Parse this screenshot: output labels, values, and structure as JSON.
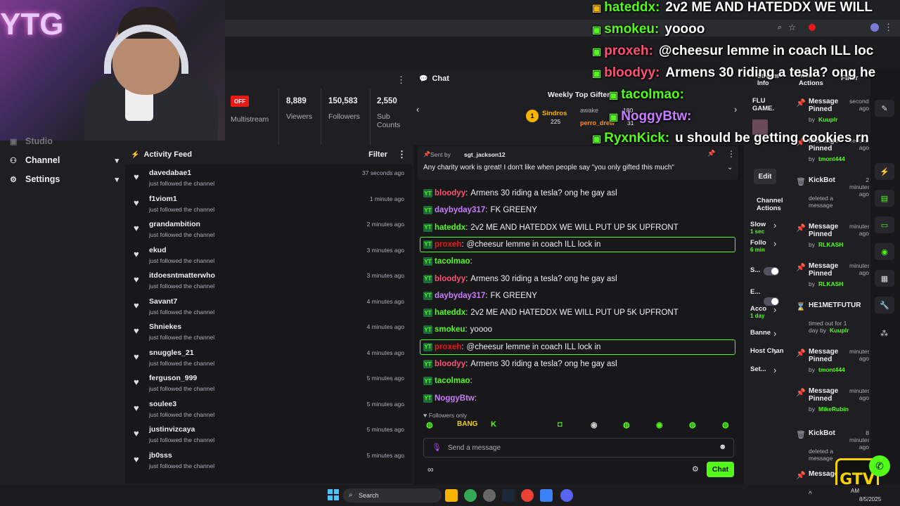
{
  "left_nav": {
    "items": [
      {
        "label": "Studio",
        "icon": "studio-icon"
      },
      {
        "label": "Channel",
        "icon": "channel-icon"
      },
      {
        "label": "Settings",
        "icon": "gear-icon"
      }
    ]
  },
  "webcam": {
    "overlay_text": "YTG"
  },
  "stream_stats": {
    "status": "OFF",
    "multistream": "Multistream",
    "viewers_value": "8,889",
    "viewers_label": "Viewers",
    "followers_value": "150,583",
    "followers_label": "Followers",
    "subs_value": "2,550",
    "subs_label": "Sub Counts"
  },
  "activity_feed": {
    "title": "Activity Feed",
    "filter": "Filter",
    "items": [
      {
        "name": "davedabae1",
        "action": "just followed the channel",
        "time": "37 seconds ago"
      },
      {
        "name": "f1viom1",
        "action": "just followed the channel",
        "time": "1 minute ago"
      },
      {
        "name": "grandambition",
        "action": "just followed the channel",
        "time": "2 minutes ago"
      },
      {
        "name": "ekud",
        "action": "just followed the channel",
        "time": "3 minutes ago"
      },
      {
        "name": "itdoesntmatterwho",
        "action": "just followed the channel",
        "time": "3 minutes ago"
      },
      {
        "name": "Savant7",
        "action": "just followed the channel",
        "time": "4 minutes ago"
      },
      {
        "name": "Shniekes",
        "action": "just followed the channel",
        "time": "4 minutes ago"
      },
      {
        "name": "snuggles_21",
        "action": "just followed the channel",
        "time": "4 minutes ago"
      },
      {
        "name": "ferguson_999",
        "action": "just followed the channel",
        "time": "5 minutes ago"
      },
      {
        "name": "soulee3",
        "action": "just followed the channel",
        "time": "5 minutes ago"
      },
      {
        "name": "justinvizcaya",
        "action": "just followed the channel",
        "time": "5 minutes ago"
      },
      {
        "name": "jb0sss",
        "action": "just followed the channel",
        "time": "5 minutes ago"
      }
    ]
  },
  "chat": {
    "title": "Chat",
    "gifters_title": "Weekly Top Gifters",
    "gifter1": {
      "rank": "1",
      "name": "Sindros",
      "count": "225"
    },
    "gifter2": {
      "name": "awake",
      "count": ""
    },
    "gifter3": {
      "name": "perro_drew",
      "count": "31"
    },
    "gifter_extra": "180",
    "pinned_by_label": "Sent by",
    "pinned_by": "sgt_jackson12",
    "pinned_text": "Any charity work is great! I don't like when people say \"you only gifted this much\"",
    "messages": [
      {
        "user": "bloodyy",
        "text": "Armens 30 riding a tesla? ong he gay asl",
        "color": "#ff4f72",
        "hl": false
      },
      {
        "user": "daybyday317",
        "text": "FK GREENY",
        "color": "#c77dff",
        "hl": false
      },
      {
        "user": "hateddx",
        "text": "2v2 ME AND HATEDDX WE WILL PUT UP 5K UPFRONT",
        "color": "#53fc18",
        "hl": false
      },
      {
        "user": "proxeh",
        "text": "@cheesur lemme in coach ILL lock in",
        "color": "#e91916",
        "hl": true
      },
      {
        "user": "tacolmao",
        "text": "",
        "color": "#53fc18",
        "hl": false
      },
      {
        "user": "bloodyy",
        "text": "Armens 30 riding a tesla? ong he gay asl",
        "color": "#ff4f72",
        "hl": false
      },
      {
        "user": "daybyday317",
        "text": "FK GREENY",
        "color": "#c77dff",
        "hl": false
      },
      {
        "user": "hateddx",
        "text": "2v2 ME AND HATEDDX WE WILL PUT UP 5K UPFRONT",
        "color": "#53fc18",
        "hl": false
      },
      {
        "user": "smokeu",
        "text": "yoooo",
        "color": "#53fc18",
        "hl": false
      },
      {
        "user": "proxeh",
        "text": "@cheesur lemme in coach ILL lock in",
        "color": "#e91916",
        "hl": true
      },
      {
        "user": "bloodyy",
        "text": "Armens 30 riding a tesla? ong he gay asl",
        "color": "#ff4f72",
        "hl": false
      },
      {
        "user": "tacolmao",
        "text": "",
        "color": "#53fc18",
        "hl": false
      },
      {
        "user": "NoggyBtw",
        "text": "",
        "color": "#c77dff",
        "hl": false
      }
    ],
    "followers_only": "Followers only",
    "emotes": [
      "BANG",
      "K"
    ],
    "input_placeholder": "Send a message",
    "send_label": "Chat"
  },
  "stream_info": {
    "title": "Stream Info",
    "game": "FLU GAME.",
    "edit_label": "Edit",
    "channel_actions": "Channel Actions",
    "settings": [
      {
        "label": "Slow",
        "value": "1 sec"
      },
      {
        "label": "Follo",
        "value": "6 min"
      },
      {
        "label": "S...",
        "value": ""
      },
      {
        "label": "E...",
        "value": ""
      },
      {
        "label": "Acco",
        "value": "1 day"
      },
      {
        "label": "Banne",
        "value": ""
      },
      {
        "label": "Host Chan",
        "value": ""
      },
      {
        "label": "Set...",
        "value": ""
      }
    ]
  },
  "mod_actions": {
    "title": "Mod Actions",
    "filter": "Filter",
    "items": [
      {
        "title": "Message Pinned",
        "time": "seconds ago",
        "by": "Kuuplr",
        "desc": "by"
      },
      {
        "title": "Message Pinned",
        "time": "seconds ago",
        "by": "tmont444",
        "desc": "by"
      },
      {
        "title": "KickBot",
        "time": "2 minutes ago",
        "by": "",
        "desc": "deleted a message"
      },
      {
        "title": "Message Pinned",
        "time": "minutes ago",
        "by": "RLKASH",
        "desc": "by"
      },
      {
        "title": "Message Pinned",
        "time": "minutes ago",
        "by": "RLKASH",
        "desc": "by"
      },
      {
        "title": "HE1METFUTUR",
        "time": "",
        "by": "Kuuplr",
        "desc": "timed out for 1 day by"
      },
      {
        "title": "Message Pinned",
        "time": "minutes ago",
        "by": "tmont444",
        "desc": "by"
      },
      {
        "title": "Message Pinned",
        "time": "minutes ago",
        "by": "MikeRubin",
        "desc": "by"
      },
      {
        "title": "KickBot",
        "time": "8 minutes ago",
        "by": "",
        "desc": "deleted a message"
      },
      {
        "title": "Message",
        "time": "",
        "by": "",
        "desc": ""
      }
    ]
  },
  "overlay_chat": [
    {
      "user": "hateddx:",
      "text": "2v2 ME AND HATEDDX WE WILL",
      "color": "#53fc18"
    },
    {
      "user": "smokeu:",
      "text": "yoooo",
      "color": "#53fc18"
    },
    {
      "user": "proxeh:",
      "text": "@cheesur lemme in coach ILL loc",
      "color": "#ff4f72"
    },
    {
      "user": "bloodyy:",
      "text": "Armens 30 riding a tesla? ong he",
      "color": "#ff4f72"
    },
    {
      "user": "tacolmao:",
      "text": "",
      "color": "#53fc18"
    },
    {
      "user": "NoggyBtw:",
      "text": "",
      "color": "#c77dff"
    },
    {
      "user": "RyxnKick:",
      "text": "u should be getting cookies rn",
      "color": "#53fc18"
    }
  ],
  "taskbar": {
    "search": "Search",
    "time": "AM",
    "date": "8/5/2025"
  },
  "colors": {
    "accent": "#53fc18",
    "bg": "#18181b",
    "panel": "#1f1f23"
  }
}
